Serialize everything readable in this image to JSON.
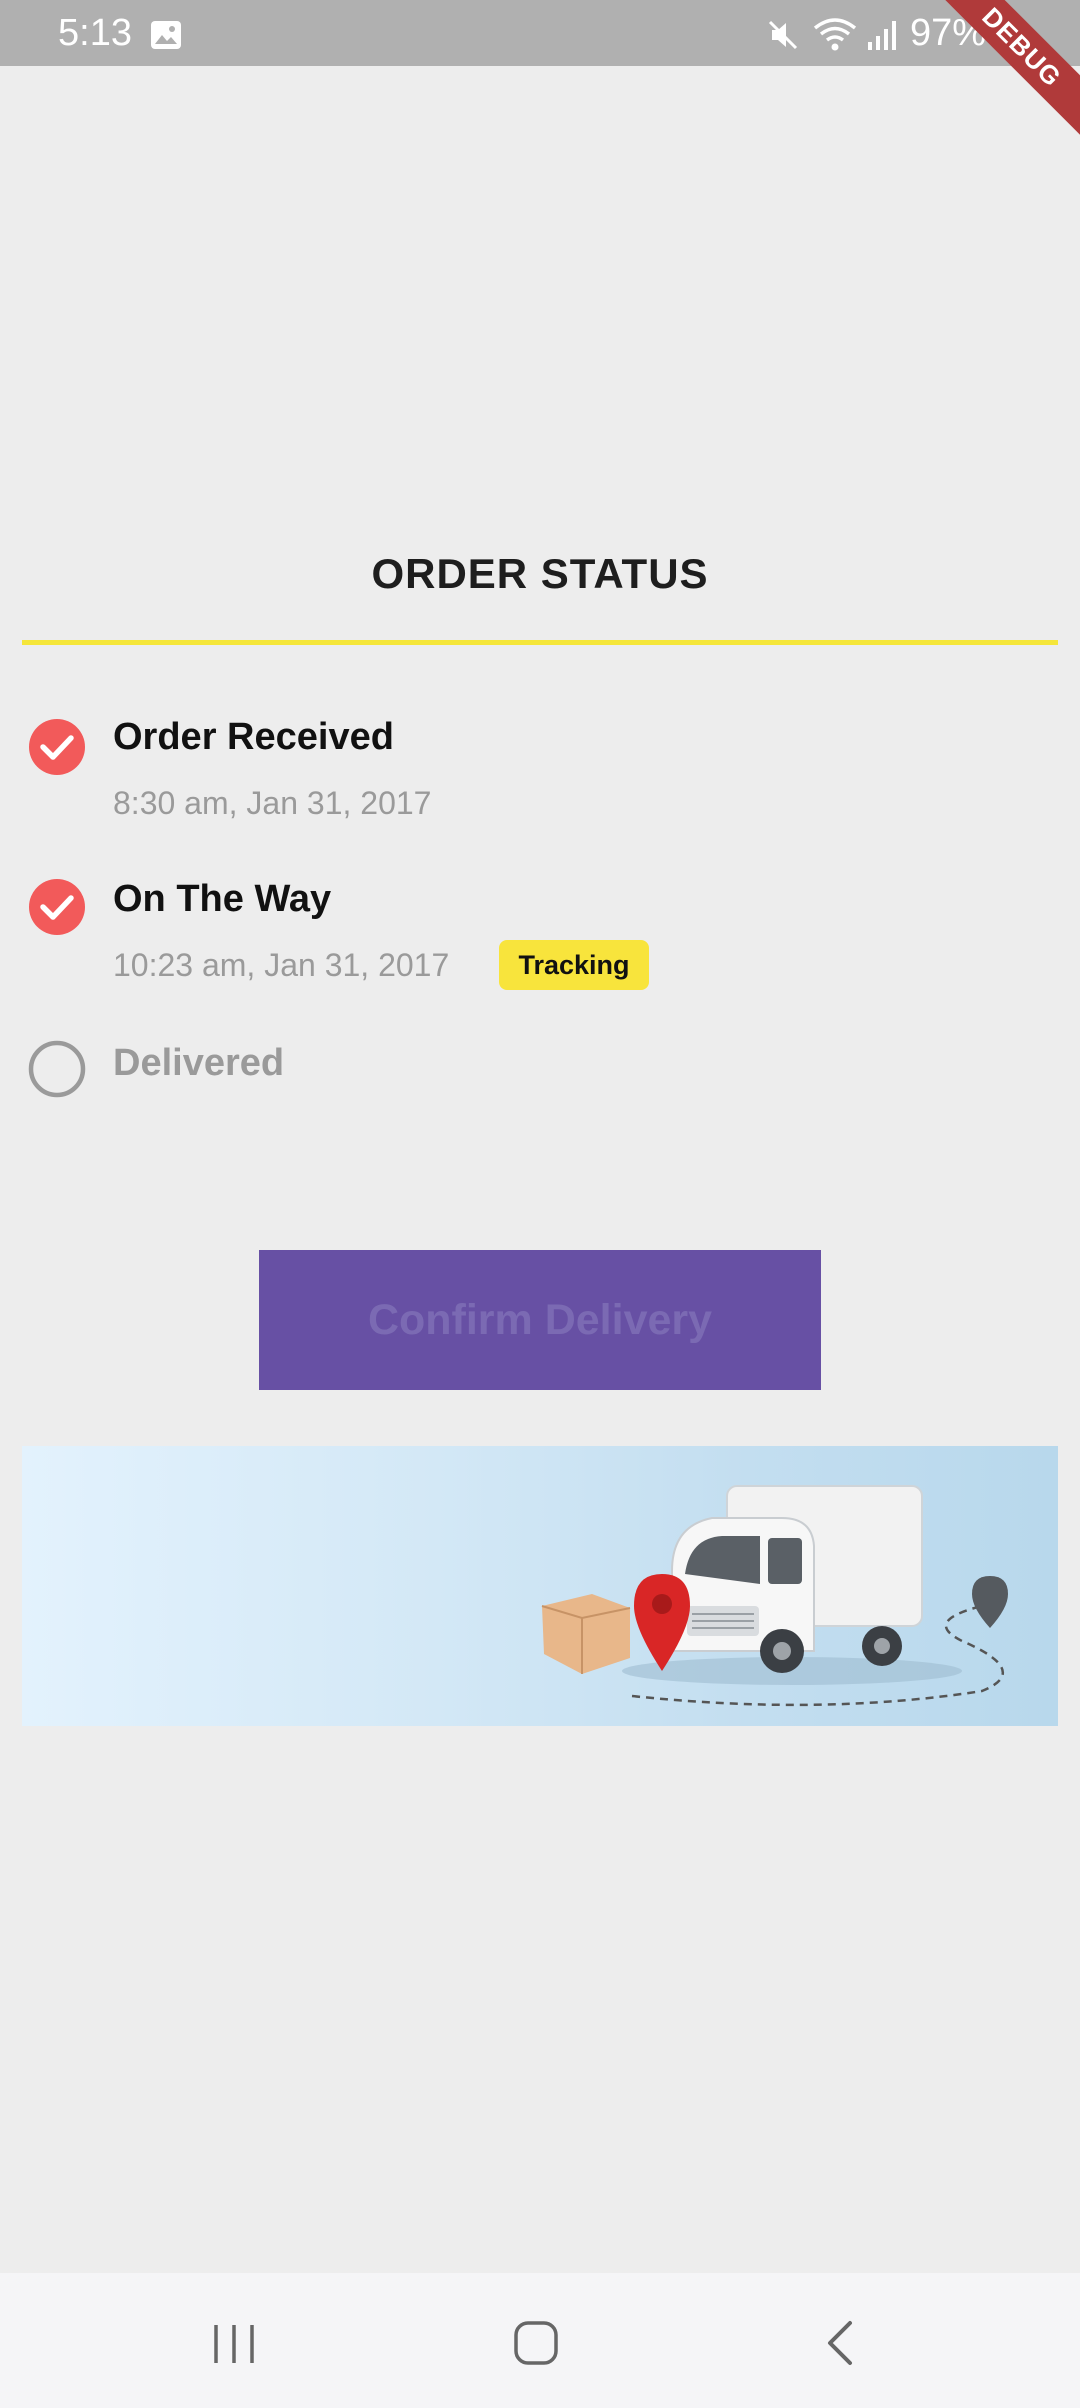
{
  "status_bar": {
    "time": "5:13",
    "battery": "97%",
    "icons": [
      "gallery-icon",
      "mute-icon",
      "wifi-icon",
      "signal-icon",
      "battery-charging-icon"
    ]
  },
  "debug_ribbon": "DEBUG",
  "header": {
    "title": "ORDER STATUS",
    "underline_color": "#f5e63a"
  },
  "steps": [
    {
      "title": "Order Received",
      "time": "8:30 am, Jan 31, 2017",
      "completed": true,
      "icon": "check-circle-icon"
    },
    {
      "title": "On The Way",
      "time": "10:23 am, Jan 31, 2017",
      "completed": true,
      "badge": "Tracking",
      "icon": "check-circle-icon"
    },
    {
      "title": "Delivered",
      "completed": false,
      "icon": "empty-circle-icon"
    }
  ],
  "confirm_button": {
    "label": "Confirm Delivery",
    "enabled": false,
    "color": "#6750a4"
  },
  "colors": {
    "check": "#f25a5a",
    "badge": "#f8e43c",
    "pending": "#9a9a9a"
  },
  "banner": {
    "illustration": "delivery-truck-illustration"
  },
  "nav_bar": {
    "buttons": [
      "recents-icon",
      "home-icon",
      "back-icon"
    ]
  }
}
